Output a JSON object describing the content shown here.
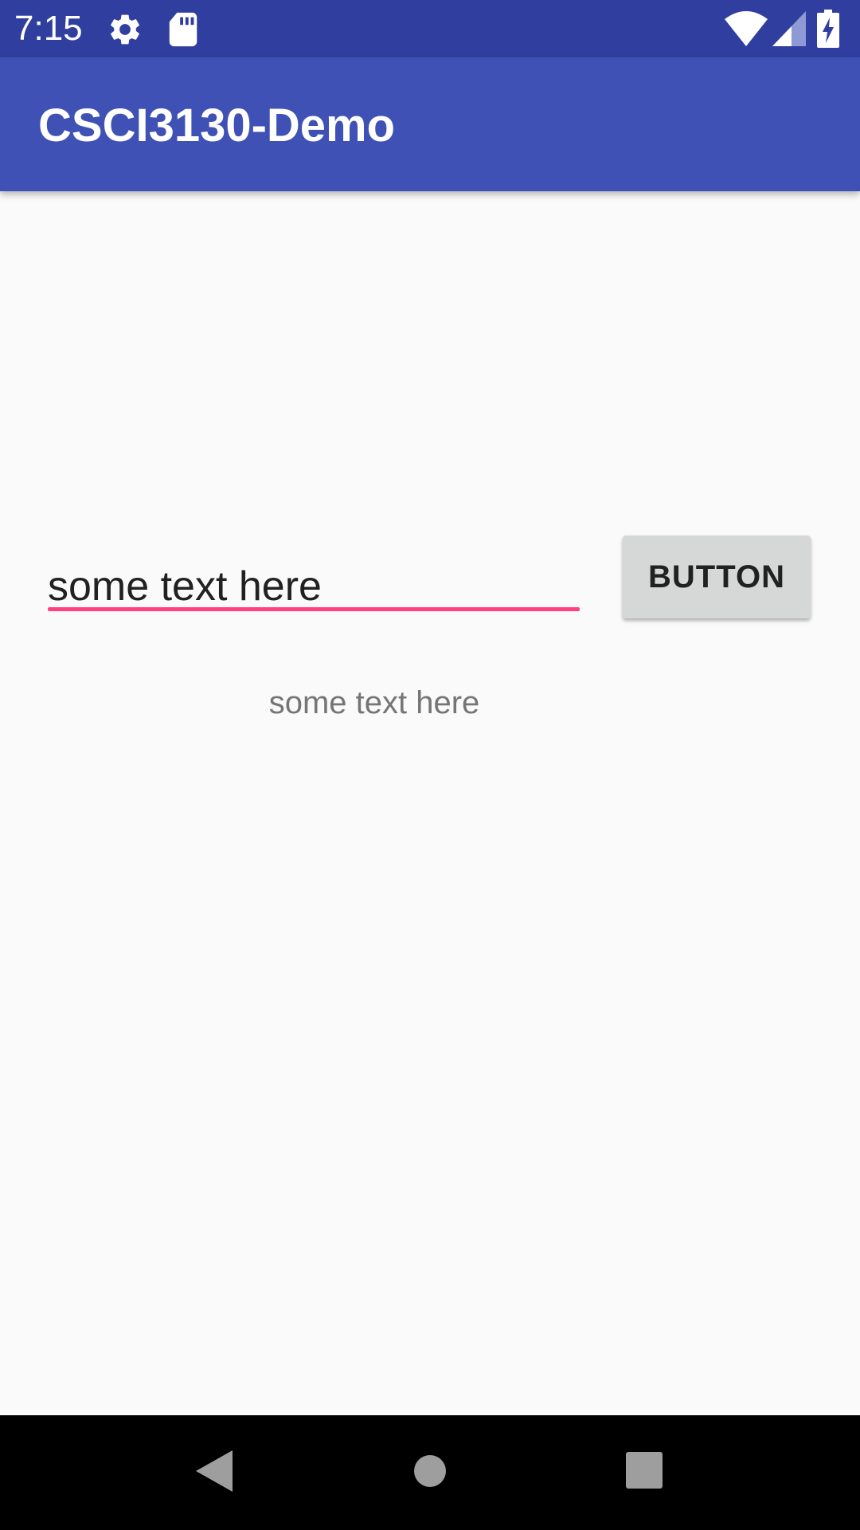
{
  "status_bar": {
    "time": "7:15",
    "icons_left": [
      "gear-icon",
      "sd-card-icon"
    ],
    "icons_right": [
      "wifi-icon",
      "signal-icon",
      "battery-charging-icon"
    ]
  },
  "app_bar": {
    "title": "CSCI3130-Demo"
  },
  "main": {
    "text_input": {
      "value": "some text here",
      "placeholder": ""
    },
    "button_label": "BUTTON",
    "output_text": "some text here"
  },
  "nav_bar": {
    "buttons": [
      "back-icon",
      "home-icon",
      "recents-icon"
    ]
  },
  "colors": {
    "status_bar": "#303f9f",
    "app_bar": "#3f51b5",
    "accent": "#ff4081",
    "background": "#fafafa",
    "button": "#d6d7d7",
    "nav_bar": "#000000"
  }
}
